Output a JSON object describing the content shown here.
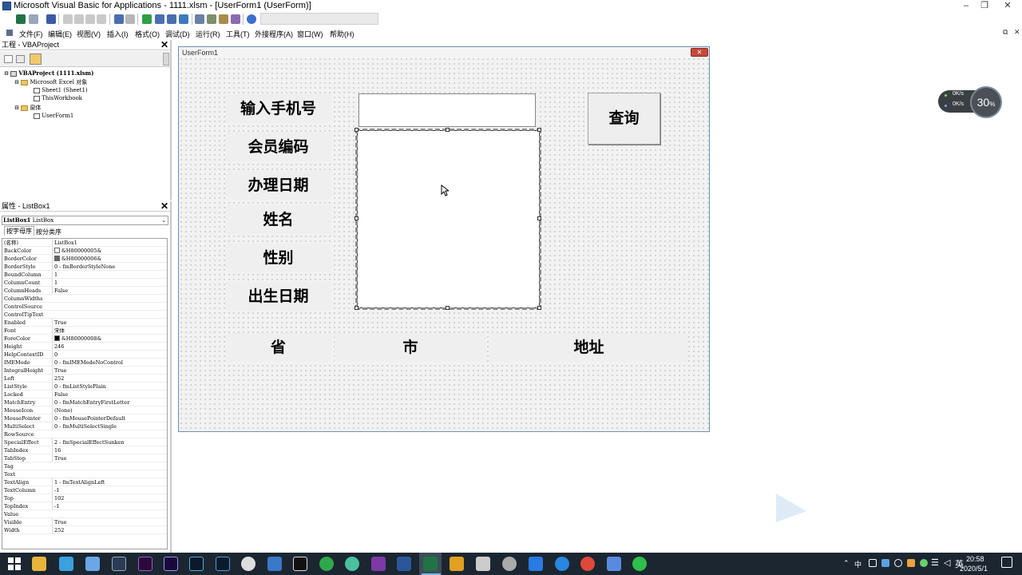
{
  "window": {
    "title": "Microsoft Visual Basic for Applications - 1111.xlsm - [UserForm1 (UserForm)]",
    "minimize": "–",
    "restore": "❐",
    "close": "✕"
  },
  "menu": {
    "items": [
      "文件(F)",
      "编辑(E)",
      "视图(V)",
      "插入(I)",
      "格式(O)",
      "调试(D)",
      "运行(R)",
      "工具(T)",
      "外接程序(A)",
      "窗口(W)",
      "帮助(H)"
    ],
    "mdi_restore": "⧉",
    "mdi_close": "✕"
  },
  "project": {
    "title": "工程 - VBAProject",
    "tree": {
      "root": "VBAProject (1111.xlsm)",
      "excel_folder": "Microsoft Excel 对象",
      "sheet1": "Sheet1 (Sheet1)",
      "thisworkbook": "ThisWorkbook",
      "forms_folder": "窗体",
      "userform1": "UserForm1"
    }
  },
  "properties": {
    "title": "属性 - ListBox1",
    "object_name": "ListBox1",
    "object_type": "ListBox",
    "tab_alpha": "按字母序",
    "tab_category": "按分类序",
    "rows": [
      {
        "name": "(名称)",
        "value": "ListBox1"
      },
      {
        "name": "BackColor",
        "value": "&H80000005&",
        "swatch": "#ffffff"
      },
      {
        "name": "BorderColor",
        "value": "&H80000006&",
        "swatch": "#646464"
      },
      {
        "name": "BorderStyle",
        "value": "0 - fmBorderStyleNone"
      },
      {
        "name": "BoundColumn",
        "value": "1"
      },
      {
        "name": "ColumnCount",
        "value": "1"
      },
      {
        "name": "ColumnHeads",
        "value": "False"
      },
      {
        "name": "ColumnWidths",
        "value": ""
      },
      {
        "name": "ControlSource",
        "value": ""
      },
      {
        "name": "ControlTipText",
        "value": ""
      },
      {
        "name": "Enabled",
        "value": "True"
      },
      {
        "name": "Font",
        "value": "宋体"
      },
      {
        "name": "ForeColor",
        "value": "&H80000008&",
        "swatch": "#000000"
      },
      {
        "name": "Height",
        "value": "246"
      },
      {
        "name": "HelpContextID",
        "value": "0"
      },
      {
        "name": "IMEMode",
        "value": "0 - fmIMEModeNoControl"
      },
      {
        "name": "IntegralHeight",
        "value": "True"
      },
      {
        "name": "Left",
        "value": "252"
      },
      {
        "name": "ListStyle",
        "value": "0 - fmListStylePlain"
      },
      {
        "name": "Locked",
        "value": "False"
      },
      {
        "name": "MatchEntry",
        "value": "0 - fmMatchEntryFirstLetter"
      },
      {
        "name": "MouseIcon",
        "value": "(None)"
      },
      {
        "name": "MousePointer",
        "value": "0 - fmMousePointerDefault"
      },
      {
        "name": "MultiSelect",
        "value": "0 - fmMultiSelectSingle"
      },
      {
        "name": "RowSource",
        "value": ""
      },
      {
        "name": "SpecialEffect",
        "value": "2 - fmSpecialEffectSunken"
      },
      {
        "name": "TabIndex",
        "value": "16"
      },
      {
        "name": "TabStop",
        "value": "True"
      },
      {
        "name": "Tag",
        "value": ""
      },
      {
        "name": "Text",
        "value": ""
      },
      {
        "name": "TextAlign",
        "value": "1 - fmTextAlignLeft"
      },
      {
        "name": "TextColumn",
        "value": "-1"
      },
      {
        "name": "Top",
        "value": "102"
      },
      {
        "name": "TopIndex",
        "value": "-1"
      },
      {
        "name": "Value",
        "value": ""
      },
      {
        "name": "Visible",
        "value": "True"
      },
      {
        "name": "Width",
        "value": "252"
      }
    ]
  },
  "userform": {
    "title": "UserForm1",
    "close": "✕",
    "labels": {
      "phone": "输入手机号",
      "member_code": "会员编码",
      "date": "办理日期",
      "name": "姓名",
      "gender": "性别",
      "birth": "出生日期",
      "province": "省",
      "city": "市",
      "address": "地址"
    },
    "query_button": "查询"
  },
  "net_widget": {
    "up": "0K/s",
    "down": "0K/s",
    "percent": "30",
    "percent_sign": "%"
  },
  "taskbar": {
    "time": "20:58",
    "date": "2020/5/1",
    "ime": "中"
  },
  "colors": {
    "form_border": "#6d8fb5",
    "taskbar": "#1b2631",
    "excel_green": "#217346"
  }
}
